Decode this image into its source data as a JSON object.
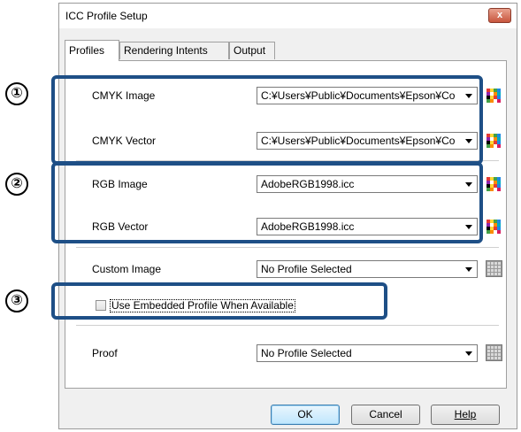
{
  "window": {
    "title": "ICC Profile Setup",
    "close_label": "x"
  },
  "tabs": [
    {
      "label": "Profiles",
      "active": true
    },
    {
      "label": "Rendering Intents",
      "active": false
    },
    {
      "label": "Output",
      "active": false
    }
  ],
  "rows": {
    "cmyk_image": {
      "label": "CMYK Image",
      "value": "C:¥Users¥Public¥Documents¥Epson¥Co"
    },
    "cmyk_vector": {
      "label": "CMYK Vector",
      "value": "C:¥Users¥Public¥Documents¥Epson¥Co"
    },
    "rgb_image": {
      "label": "RGB Image",
      "value": "AdobeRGB1998.icc"
    },
    "rgb_vector": {
      "label": "RGB Vector",
      "value": "AdobeRGB1998.icc"
    },
    "custom_image": {
      "label": "Custom Image",
      "value": "No Profile Selected"
    },
    "proof": {
      "label": "Proof",
      "value": "No Profile Selected"
    }
  },
  "checkbox": {
    "label": "Use Embedded Profile When Available",
    "checked": false
  },
  "buttons": {
    "ok": "OK",
    "cancel": "Cancel",
    "help": "Help"
  },
  "callouts": [
    "①",
    "②",
    "③"
  ],
  "colors": {
    "callout_border": "#1e4f86",
    "dialog_bg": "#f0f0f0"
  }
}
